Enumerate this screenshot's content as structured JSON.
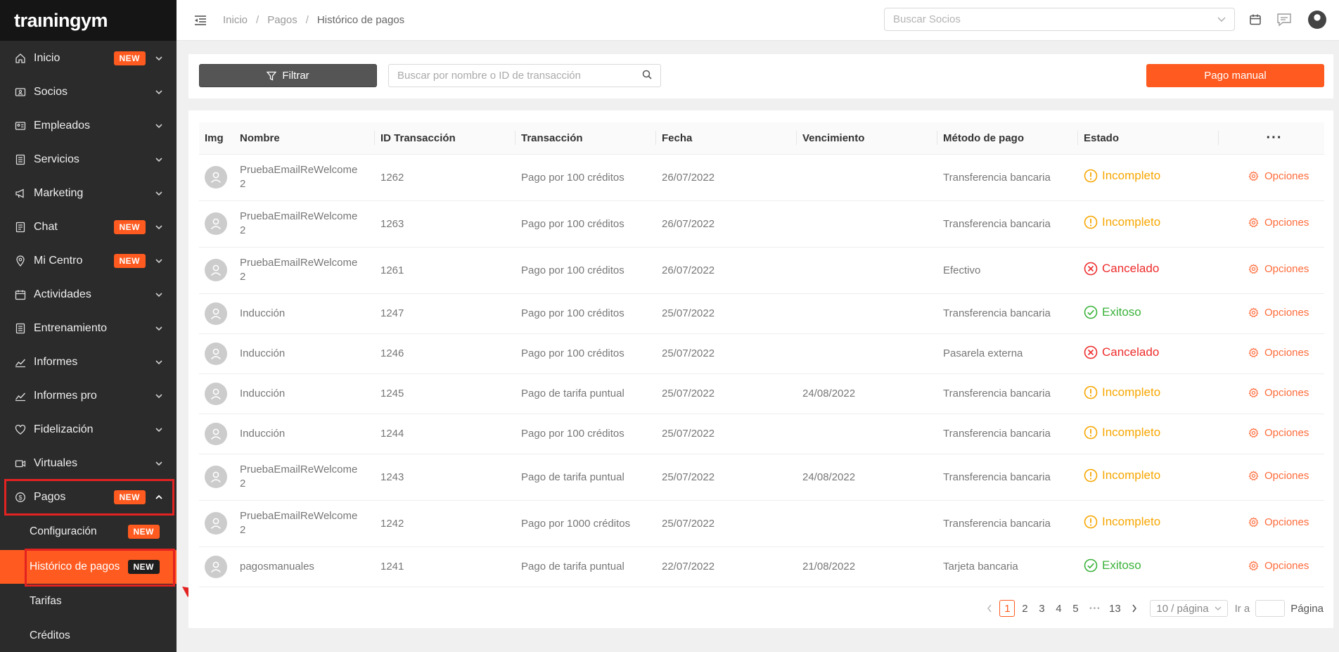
{
  "logo": "traıningym",
  "sidebar": {
    "items": [
      {
        "label": "Inicio",
        "badge": "NEW",
        "icon": "home-icon"
      },
      {
        "label": "Socios",
        "badge": "",
        "icon": "id-card-icon"
      },
      {
        "label": "Empleados",
        "badge": "",
        "icon": "badge-card-icon"
      },
      {
        "label": "Servicios",
        "badge": "",
        "icon": "list-icon"
      },
      {
        "label": "Marketing",
        "badge": "",
        "icon": "megaphone-icon"
      },
      {
        "label": "Chat",
        "badge": "NEW",
        "icon": "chat-icon"
      },
      {
        "label": "Mi Centro",
        "badge": "NEW",
        "icon": "location-icon"
      },
      {
        "label": "Actividades",
        "badge": "",
        "icon": "calendar-icon"
      },
      {
        "label": "Entrenamiento",
        "badge": "",
        "icon": "dumbbell-icon"
      },
      {
        "label": "Informes",
        "badge": "",
        "icon": "line-chart-icon"
      },
      {
        "label": "Informes pro",
        "badge": "",
        "icon": "line-chart-icon"
      },
      {
        "label": "Fidelización",
        "badge": "",
        "icon": "heart-icon"
      },
      {
        "label": "Virtuales",
        "badge": "",
        "icon": "video-icon"
      },
      {
        "label": "Pagos",
        "badge": "NEW",
        "icon": "coin-icon"
      }
    ],
    "sub_items": [
      {
        "label": "Configuración",
        "badge": "NEW"
      },
      {
        "label": "Histórico de pagos",
        "badge": "NEW"
      },
      {
        "label": "Tarifas",
        "badge": ""
      },
      {
        "label": "Créditos",
        "badge": ""
      }
    ]
  },
  "topbar": {
    "breadcrumb": [
      "Inicio",
      "Pagos",
      "Histórico de pagos"
    ],
    "search_placeholder": "Buscar Socios"
  },
  "toolbar": {
    "filter_label": "Filtrar",
    "search_placeholder": "Buscar por nombre o ID de transacción",
    "manual_label": "Pago manual"
  },
  "table": {
    "columns": [
      "Img",
      "Nombre",
      "ID Transacción",
      "Transacción",
      "Fecha",
      "Vencimiento",
      "Método de pago",
      "Estado",
      "···"
    ],
    "options_label": "Opciones",
    "rows": [
      {
        "name": [
          "PruebaEmailReWelcome",
          "2"
        ],
        "id": "1262",
        "tx": "Pago por 100 créditos",
        "date": "26/07/2022",
        "due": "",
        "method": "Transferencia bancaria",
        "status": "Incompleto",
        "status_type": "incompleto"
      },
      {
        "name": [
          "PruebaEmailReWelcome",
          "2"
        ],
        "id": "1263",
        "tx": "Pago por 100 créditos",
        "date": "26/07/2022",
        "due": "",
        "method": "Transferencia bancaria",
        "status": "Incompleto",
        "status_type": "incompleto"
      },
      {
        "name": [
          "PruebaEmailReWelcome",
          "2"
        ],
        "id": "1261",
        "tx": "Pago por 100 créditos",
        "date": "26/07/2022",
        "due": "",
        "method": "Efectivo",
        "status": "Cancelado",
        "status_type": "cancelado"
      },
      {
        "name": [
          "Inducción"
        ],
        "id": "1247",
        "tx": "Pago por 100 créditos",
        "date": "25/07/2022",
        "due": "",
        "method": "Transferencia bancaria",
        "status": "Exitoso",
        "status_type": "exitoso"
      },
      {
        "name": [
          "Inducción"
        ],
        "id": "1246",
        "tx": "Pago por 100 créditos",
        "date": "25/07/2022",
        "due": "",
        "method": "Pasarela externa",
        "status": "Cancelado",
        "status_type": "cancelado"
      },
      {
        "name": [
          "Inducción"
        ],
        "id": "1245",
        "tx": "Pago de tarifa puntual",
        "date": "25/07/2022",
        "due": "24/08/2022",
        "method": "Transferencia bancaria",
        "status": "Incompleto",
        "status_type": "incompleto"
      },
      {
        "name": [
          "Inducción"
        ],
        "id": "1244",
        "tx": "Pago por 100 créditos",
        "date": "25/07/2022",
        "due": "",
        "method": "Transferencia bancaria",
        "status": "Incompleto",
        "status_type": "incompleto"
      },
      {
        "name": [
          "PruebaEmailReWelcome",
          "2"
        ],
        "id": "1243",
        "tx": "Pago de tarifa puntual",
        "date": "25/07/2022",
        "due": "24/08/2022",
        "method": "Transferencia bancaria",
        "status": "Incompleto",
        "status_type": "incompleto"
      },
      {
        "name": [
          "PruebaEmailReWelcome",
          "2"
        ],
        "id": "1242",
        "tx": "Pago por 1000 créditos",
        "date": "25/07/2022",
        "due": "",
        "method": "Transferencia bancaria",
        "status": "Incompleto",
        "status_type": "incompleto"
      },
      {
        "name": [
          "pagosmanuales"
        ],
        "id": "1241",
        "tx": "Pago de tarifa puntual",
        "date": "22/07/2022",
        "due": "21/08/2022",
        "method": "Tarjeta bancaria",
        "status": "Exitoso",
        "status_type": "exitoso"
      }
    ]
  },
  "pagination": {
    "pages": [
      "1",
      "2",
      "3",
      "4",
      "5",
      "•••",
      "13"
    ],
    "active": "1",
    "page_size": "10 / página",
    "goto_label": "Ir a",
    "page_label": "Página"
  },
  "colors": {
    "accent": "#ff5a1f",
    "sidebar_bg": "#2b2b2b",
    "incompleto": "#f7a600",
    "cancelado": "#ee2c2c",
    "exitoso": "#3ab23a",
    "highlight": "#e32222"
  }
}
